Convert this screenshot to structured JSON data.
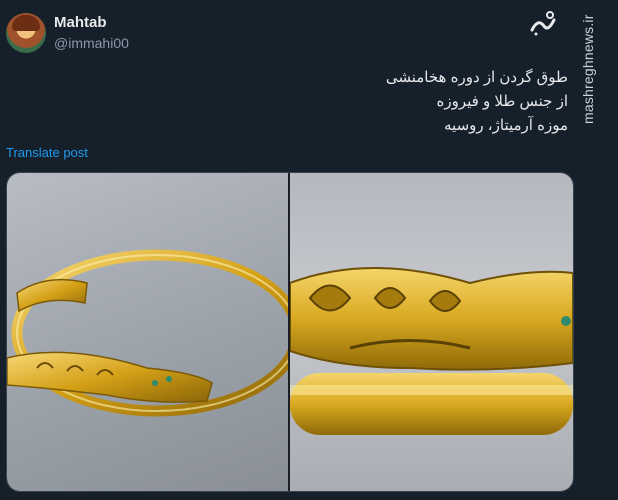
{
  "author": {
    "display_name": "Mahtab",
    "handle": "@immahi00"
  },
  "watermark": {
    "logo_text": "مشرق",
    "site": "mashreghnews.ir"
  },
  "post": {
    "lines": [
      "طوق گردن از دوره هخامنشی",
      "از جنس طلا و فیروزه",
      "موزه آرمیتاژ، روسیه"
    ]
  },
  "actions": {
    "translate_label": "Translate post"
  },
  "media": {
    "count": 2
  },
  "colors": {
    "background": "#15202b",
    "text": "#e7e9ea",
    "secondary": "#8b98a5",
    "link": "#1d9bf0",
    "gold": "#d4a017"
  }
}
